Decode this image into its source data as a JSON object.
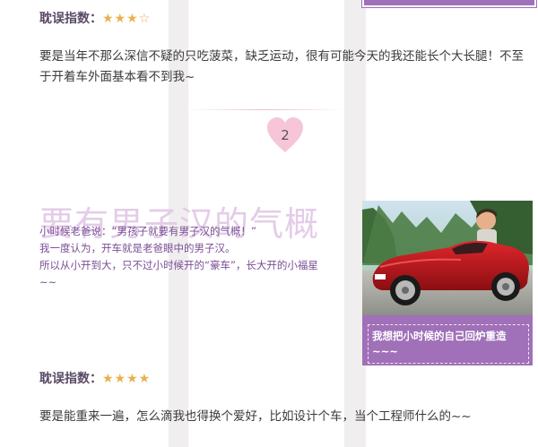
{
  "top_rating": {
    "label": "耽误指数：",
    "stars_filled": "★★★",
    "stars_empty": "☆"
  },
  "top_paragraph": "要是当年不那么深信不疑的只吃菠菜，缺乏运动，很有可能今天的我还能长个大长腿！不至于开着车外面基本看不到我~",
  "section": {
    "number": "2",
    "title": "要有男子汉的气概",
    "lines": [
      "小时候老爸说：“男孩子就要有男子汉的气概！”",
      "我一度认为，开车就是老爸眼中的男子汉。",
      "所以从小开到大，只不过小时候开的“豪车”，长大开的小福星",
      "~~"
    ],
    "photo_caption": "我想把小时候的自己回炉重造~~~"
  },
  "bottom_rating": {
    "label": "耽误指数：",
    "stars_filled": "★★★★"
  },
  "bottom_paragraph": "要是能重来一遍，怎么滴我也得换个爱好，比如设计个车，当个工程师什么的~~",
  "colors": {
    "accent_purple": "#a070b8",
    "heart_pink": "#f6c6d8",
    "star_gold": "#e9b04e",
    "car_red": "#c4161c"
  }
}
